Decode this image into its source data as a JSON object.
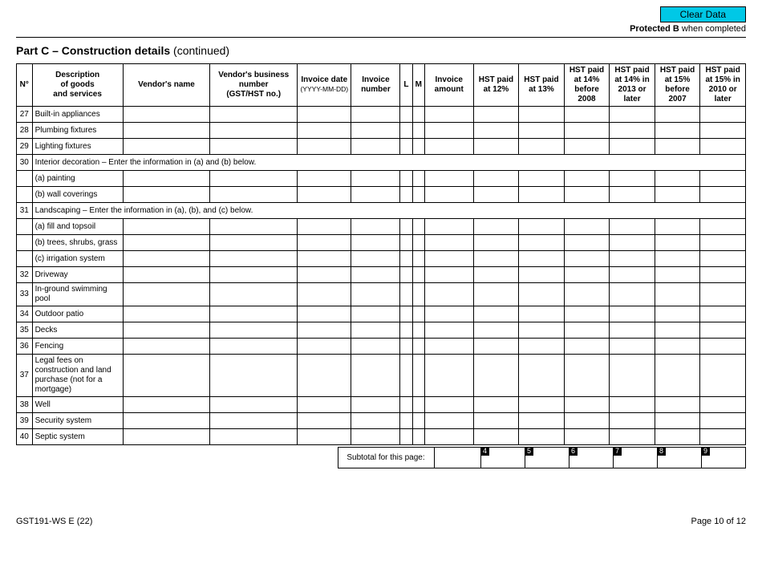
{
  "buttons": {
    "clear": "Clear Data"
  },
  "header": {
    "protected_strong": "Protected B",
    "protected_rest": " when completed",
    "part_strong": "Part C – Construction details",
    "part_rest": " (continued)"
  },
  "columns": {
    "n": "N°",
    "desc_l1": "Description",
    "desc_l2": "of goods",
    "desc_l3": "and services",
    "vendor": "Vendor's name",
    "biz_l1": "Vendor's business",
    "biz_l2": "number",
    "biz_l3": "(GST/HST no.)",
    "invdate_l1": "Invoice date",
    "invdate_l2": "(YYYY-MM-DD)",
    "invnum_l1": "Invoice",
    "invnum_l2": "number",
    "l": "L",
    "m": "M",
    "amt_l1": "Invoice",
    "amt_l2": "amount",
    "h12_l1": "HST paid",
    "h12_l2": "at 12%",
    "h13_l1": "HST paid",
    "h13_l2": "at 13%",
    "h14b_l1": "HST paid",
    "h14b_l2": "at 14%",
    "h14b_l3": "before",
    "h14b_l4": "2008",
    "h14a_l1": "HST paid",
    "h14a_l2": "at 14% in",
    "h14a_l3": "2013 or",
    "h14a_l4": "later",
    "h15b_l1": "HST paid",
    "h15b_l2": "at 15%",
    "h15b_l3": "before",
    "h15b_l4": "2007",
    "h15a_l1": "HST paid",
    "h15a_l2": "at 15% in",
    "h15a_l3": "2010 or",
    "h15a_l4": "later"
  },
  "rows": {
    "r27": {
      "n": "27",
      "d": "Built-in appliances"
    },
    "r28": {
      "n": "28",
      "d": "Plumbing fixtures"
    },
    "r29": {
      "n": "29",
      "d": "Lighting fixtures"
    },
    "r30": {
      "n": "30",
      "d": "Interior decoration – Enter the information in (a) and (b) below."
    },
    "r30a": {
      "d": "(a) painting"
    },
    "r30b": {
      "d": "(b) wall coverings"
    },
    "r31": {
      "n": "31",
      "d": "Landscaping – Enter the information in (a), (b), and (c) below."
    },
    "r31a": {
      "d": "(a) fill and topsoil"
    },
    "r31b": {
      "d": "(b) trees, shrubs, grass"
    },
    "r31c": {
      "d": "(c) irrigation system"
    },
    "r32": {
      "n": "32",
      "d": "Driveway"
    },
    "r33": {
      "n": "33",
      "d": "In-ground swimming pool"
    },
    "r34": {
      "n": "34",
      "d": "Outdoor patio"
    },
    "r35": {
      "n": "35",
      "d": "Decks"
    },
    "r36": {
      "n": "36",
      "d": "Fencing"
    },
    "r37": {
      "n": "37",
      "d": "Legal fees on construction and land purchase (not for a mortgage)"
    },
    "r38": {
      "n": "38",
      "d": "Well"
    },
    "r39": {
      "n": "39",
      "d": "Security system"
    },
    "r40": {
      "n": "40",
      "d": "Septic system"
    }
  },
  "subtotal": {
    "label": "Subtotal for this page:",
    "tags": {
      "t4": "4",
      "t5": "5",
      "t6": "6",
      "t7": "7",
      "t8": "8",
      "t9": "9"
    }
  },
  "footer": {
    "form": "GST191-WS E (22)",
    "page": "Page 10 of 12"
  }
}
